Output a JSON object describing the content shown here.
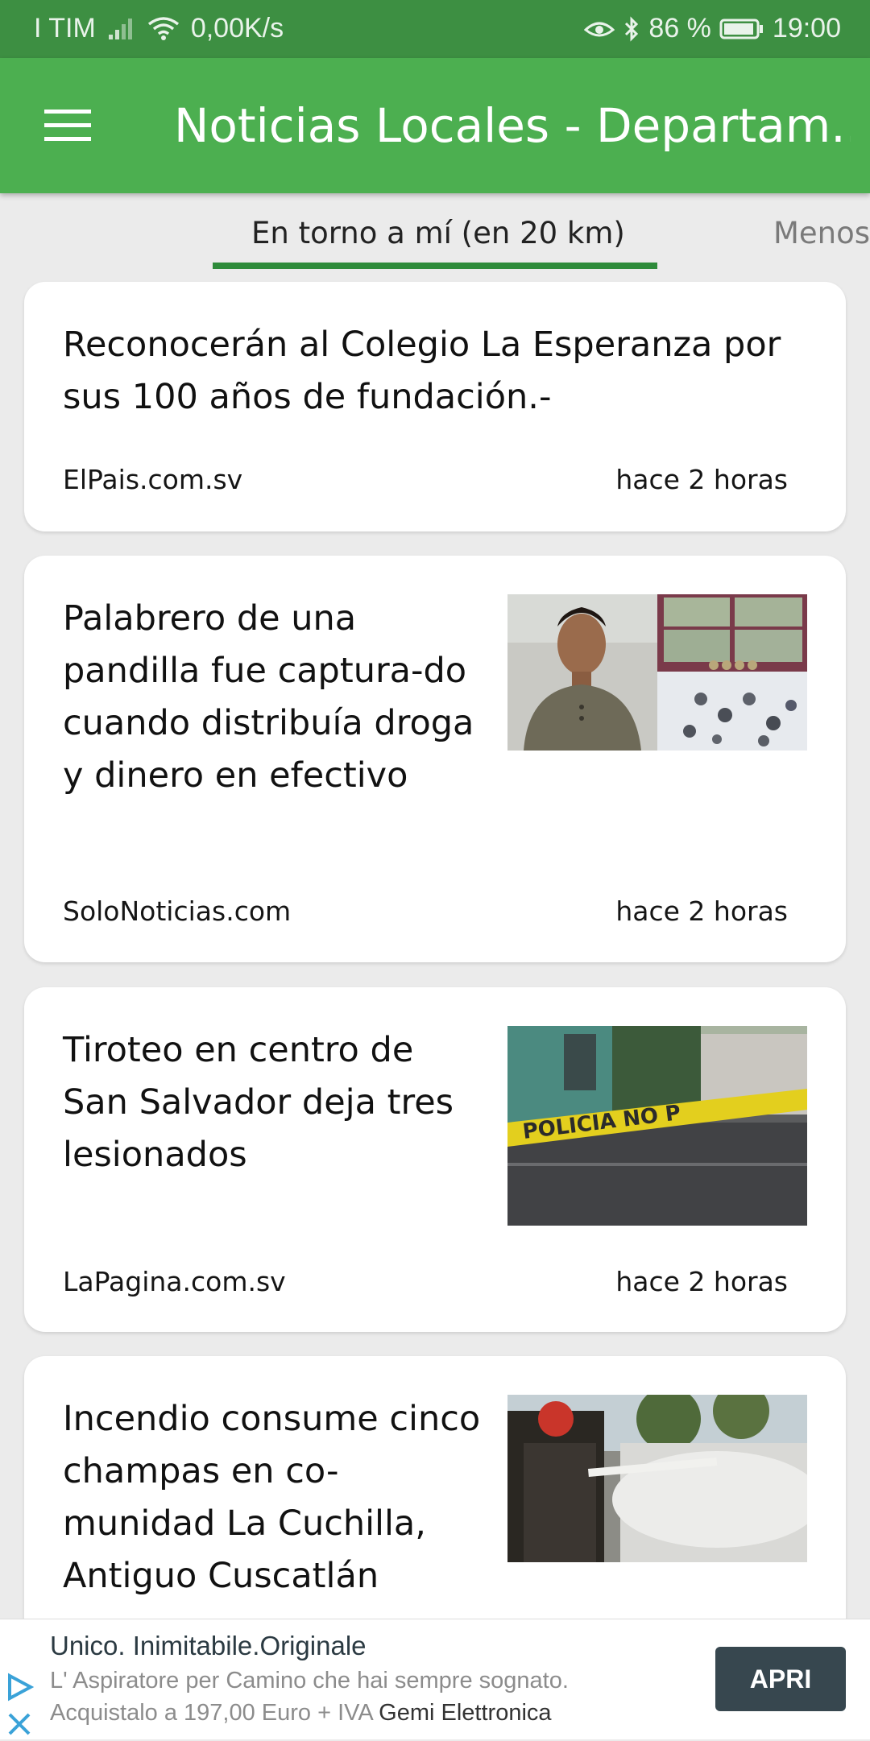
{
  "status_bar": {
    "carrier": "I TIM",
    "net_speed": "0,00K/s",
    "battery": "86 %",
    "time": "19:00"
  },
  "app_bar": {
    "title": "Noticias Locales - Departam..."
  },
  "tabs": [
    {
      "label": "En torno a mí (en 20 km)",
      "selected": true
    },
    {
      "label": "Menos",
      "selected": false
    }
  ],
  "articles": [
    {
      "headline": "Reconocerán al Colegio La Esperanza por sus 100 años de fundación.-",
      "source": "ElPais.com.sv",
      "time": "hace 2 horas",
      "has_image": false
    },
    {
      "headline": "Palabrero de una pandilla fue captura-do cuando distribuía droga y dinero en efectivo",
      "source": "SoloNoticias.com",
      "time": "hace 2 horas",
      "has_image": true
    },
    {
      "headline": "Tiroteo en centro de San Salvador deja tres lesionados",
      "source": "LaPagina.com.sv",
      "time": "hace 2 horas",
      "has_image": true,
      "image_text": "POLICIA NO P"
    },
    {
      "headline": "Incendio consume cinco champas en co-munidad La Cuchilla, Antiguo Cuscatlán",
      "source": "",
      "time": "",
      "has_image": true
    }
  ],
  "ad": {
    "title": "Unico. Inimitabile.Originale",
    "line1": "L' Aspiratore per Camino che hai sempre sognato.",
    "line2": "Acquistalo a 197,00 Euro + IVA",
    "advertiser": "Gemi Elettronica",
    "button": "APRI"
  },
  "colors": {
    "status_bar": "#3d8f42",
    "app_bar": "#4caf50",
    "tab_indicator": "#2e8b3a",
    "background": "#ebebeb",
    "ad_button": "#37474f"
  }
}
